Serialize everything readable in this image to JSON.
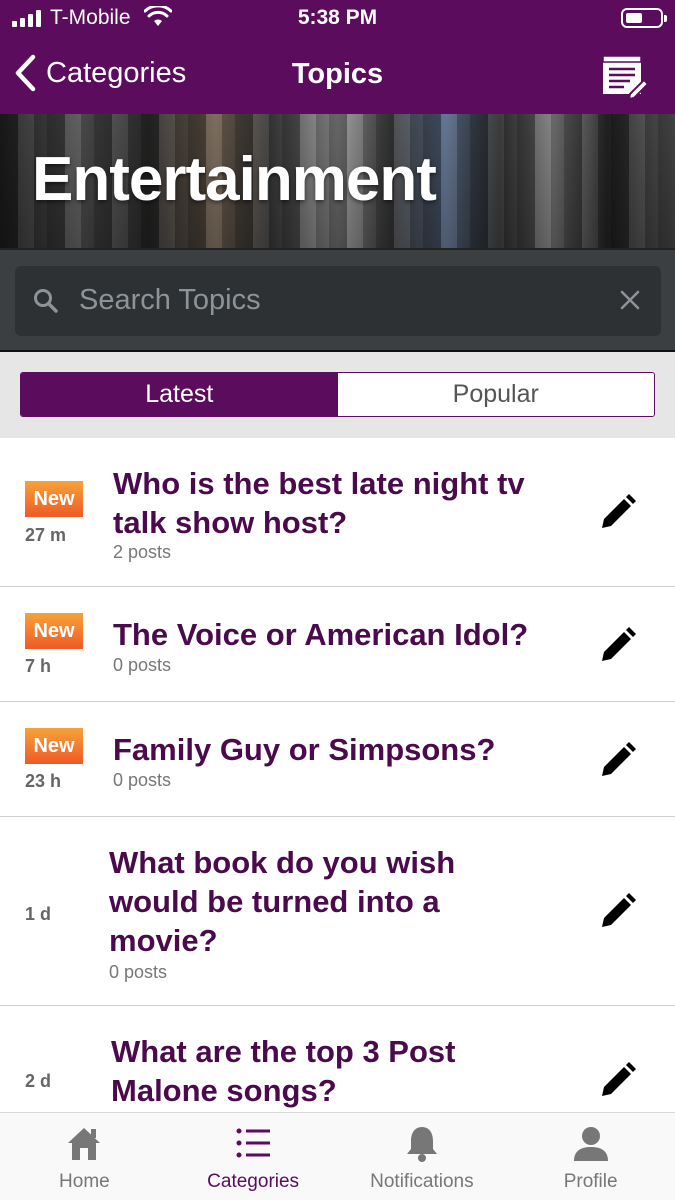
{
  "status_bar": {
    "carrier": "T-Mobile",
    "time": "5:38 PM"
  },
  "nav": {
    "back_label": "Categories",
    "title": "Topics",
    "compose_icon": "compose-icon"
  },
  "hero": {
    "title": "Entertainment"
  },
  "search": {
    "placeholder": "Search Topics"
  },
  "segments": {
    "latest": "Latest",
    "popular": "Popular",
    "selected": "Latest"
  },
  "topics": [
    {
      "badge": "New",
      "age": "27 m",
      "title": "Who is the best late night tv talk show host?",
      "posts": "2 posts"
    },
    {
      "badge": "New",
      "age": "7 h",
      "title": "The Voice or American Idol?",
      "posts": "0 posts"
    },
    {
      "badge": "New",
      "age": "23 h",
      "title": "Family Guy or Simpsons?",
      "posts": "0 posts"
    },
    {
      "badge": "",
      "age": "1 d",
      "title": "What book do you wish would be turned into a movie?",
      "posts": "0 posts"
    },
    {
      "badge": "",
      "age": "2 d",
      "title": "What are the top 3 Post Malone songs?",
      "posts": ""
    }
  ],
  "tabbar": {
    "home": "Home",
    "categories": "Categories",
    "notifications": "Notifications",
    "profile": "Profile",
    "active": "Categories"
  },
  "colors": {
    "brand_purple": "#5b0c5c",
    "title_purple": "#4a0a4c",
    "badge_top": "#f6a23a",
    "badge_bottom": "#ee5a26"
  }
}
